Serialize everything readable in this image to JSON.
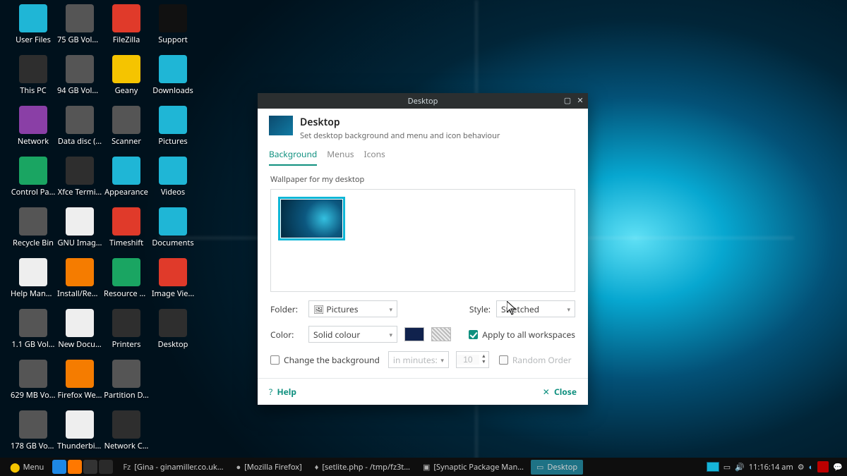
{
  "desktop": {
    "icons": [
      {
        "label": "User Files",
        "color": "cyan"
      },
      {
        "label": "This PC",
        "color": "dgrey"
      },
      {
        "label": "Network",
        "color": "purple"
      },
      {
        "label": "Control Pa…",
        "color": "green"
      },
      {
        "label": "Recycle Bin",
        "color": "grey"
      },
      {
        "label": "Help Manual",
        "color": "white"
      },
      {
        "label": "1.1 GB Vol…",
        "color": "grey"
      },
      {
        "label": "629 MB Vol…",
        "color": "grey"
      },
      {
        "label": "178 GB Vol…",
        "color": "grey"
      },
      {
        "label": "75 GB Volu…",
        "color": "grey"
      },
      {
        "label": "94 GB Volu…",
        "color": "grey"
      },
      {
        "label": "Data disc (…",
        "color": "grey"
      },
      {
        "label": "Xfce Termi…",
        "color": "dgrey"
      },
      {
        "label": "GNU Imag…",
        "color": "white"
      },
      {
        "label": "Install/Rem…",
        "color": "orange"
      },
      {
        "label": "New Docu…",
        "color": "white"
      },
      {
        "label": "Firefox We…",
        "color": "orange"
      },
      {
        "label": "Thunderbir…",
        "color": "white"
      },
      {
        "label": "FileZilla",
        "color": "red"
      },
      {
        "label": "Geany",
        "color": "yellow"
      },
      {
        "label": "Scanner",
        "color": "grey"
      },
      {
        "label": "Appearance",
        "color": "cyan"
      },
      {
        "label": "Timeshift",
        "color": "red"
      },
      {
        "label": "Resource U…",
        "color": "green"
      },
      {
        "label": "Printers",
        "color": "dgrey"
      },
      {
        "label": "Partition D…",
        "color": "grey"
      },
      {
        "label": "Network C…",
        "color": "dgrey"
      },
      {
        "label": "Support",
        "color": "black"
      },
      {
        "label": "Downloads",
        "color": "cyan"
      },
      {
        "label": "Pictures",
        "color": "cyan"
      },
      {
        "label": "Videos",
        "color": "cyan"
      },
      {
        "label": "Documents",
        "color": "cyan"
      },
      {
        "label": "Image Vie…",
        "color": "red"
      },
      {
        "label": "Desktop",
        "color": "dgrey"
      }
    ]
  },
  "dialog": {
    "titlebar": "Desktop",
    "heading": "Desktop",
    "subheading": "Set desktop background and menu and icon behaviour",
    "tabs": {
      "background": "Background",
      "menus": "Menus",
      "icons": "Icons"
    },
    "wallpaper_label": "Wallpaper for my desktop",
    "folder_label": "Folder:",
    "folder_value": "🖼 Pictures",
    "style_label": "Style:",
    "style_value": "Stretched",
    "color_label": "Color:",
    "color_value": "Solid colour",
    "apply_all_label": "Apply to all workspaces",
    "apply_all_checked": true,
    "change_bg_label": "Change the background",
    "change_bg_checked": false,
    "interval_placeholder": "in minutes:",
    "interval_value": "10",
    "random_label": "Random Order",
    "random_checked": false,
    "help_label": "Help",
    "close_label": "Close"
  },
  "taskbar": {
    "menu_label": "Menu",
    "tasks": [
      {
        "label": "[Gina - ginamiller.co.uk…",
        "glyph": "Fz",
        "active": false
      },
      {
        "label": "[Mozilla Firefox]",
        "glyph": "●",
        "active": false
      },
      {
        "label": "[setlite.php - /tmp/fz3t…",
        "glyph": "♦",
        "active": false
      },
      {
        "label": "[Synaptic Package Man…",
        "glyph": "▣",
        "active": false
      },
      {
        "label": "Desktop",
        "glyph": "▭",
        "active": true
      }
    ],
    "clock": "11:16:14 am"
  }
}
